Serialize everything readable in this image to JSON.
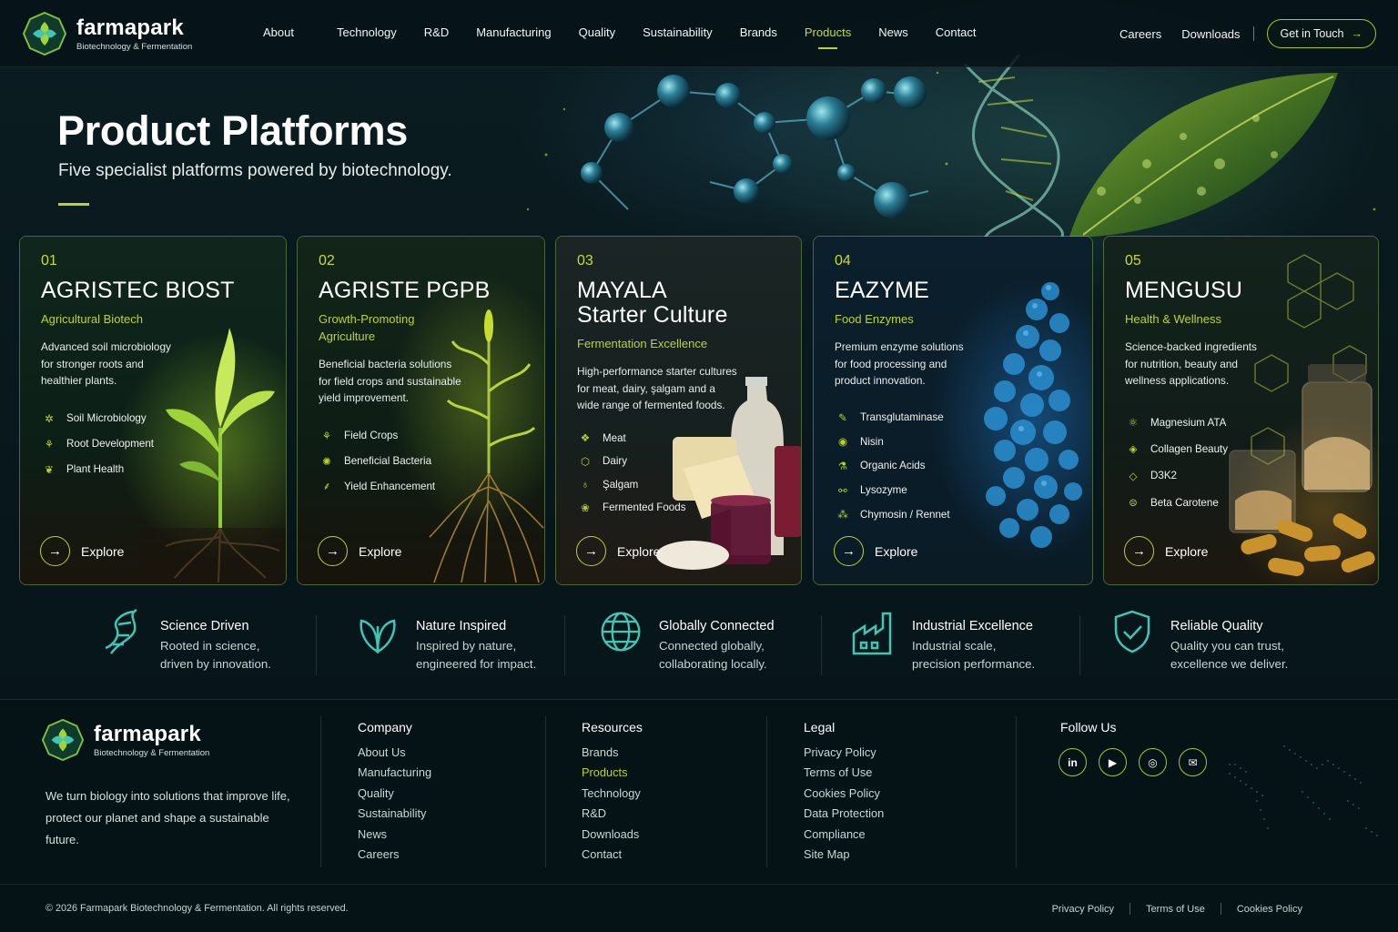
{
  "brand": {
    "name": "farmapark",
    "tagline": "Biotechnology & Fermentation"
  },
  "nav": {
    "items": [
      "About",
      "Technology",
      "R&D",
      "Manufacturing",
      "Quality",
      "Sustainability",
      "Brands",
      "Products",
      "News",
      "Contact"
    ],
    "active": "Products",
    "right": {
      "careers": "Careers",
      "downloads": "Downloads",
      "cta": "Get in Touch"
    }
  },
  "hero": {
    "title": "Product Platforms",
    "subtitle": "Five specialist platforms powered by biotechnology."
  },
  "cards": [
    {
      "num": "01",
      "title": "AGRISTEC BIOST",
      "category": "Agricultural Biotech",
      "desc": [
        "Advanced soil microbiology",
        "for stronger roots and",
        "healthier plants."
      ],
      "features": [
        {
          "icon": "microbe-icon",
          "label": "Soil Microbiology"
        },
        {
          "icon": "root-icon",
          "label": "Root Development"
        },
        {
          "icon": "leaf-icon",
          "label": "Plant Health"
        }
      ],
      "explore": "Explore"
    },
    {
      "num": "02",
      "title": "AGRISTE PGPB",
      "category": [
        "Growth-Promoting",
        "Agriculture"
      ],
      "desc": [
        "Beneficial bacteria solutions",
        "for field crops and sustainable",
        "yield improvement."
      ],
      "features": [
        {
          "icon": "sprout-icon",
          "label": "Field Crops"
        },
        {
          "icon": "bacteria-icon",
          "label": "Beneficial Bacteria"
        },
        {
          "icon": "wheat-icon",
          "label": "Yield Enhancement"
        }
      ],
      "explore": "Explore"
    },
    {
      "num": "03",
      "title": [
        "MAYALA",
        "Starter Culture"
      ],
      "category": "Fermentation Excellence",
      "desc": [
        "High-performance starter cultures",
        "for meat, dairy, şalgam and a",
        "wide range of fermented foods."
      ],
      "features": [
        {
          "icon": "meat-icon",
          "label": "Meat"
        },
        {
          "icon": "milk-drop-icon",
          "label": "Dairy"
        },
        {
          "icon": "turnip-icon",
          "label": "Şalgam"
        },
        {
          "icon": "jar-icon",
          "label": "Fermented Foods"
        }
      ],
      "explore": "Explore"
    },
    {
      "num": "04",
      "title": "EAZYME",
      "category": "Food Enzymes",
      "desc": [
        "Premium enzyme solutions",
        "for food processing and",
        "product innovation."
      ],
      "features": [
        {
          "icon": "enzyme-icon",
          "label": "Transglutaminase"
        },
        {
          "icon": "shield-drop-icon",
          "label": "Nisin"
        },
        {
          "icon": "flask-icon",
          "label": "Organic Acids"
        },
        {
          "icon": "molecule-icon",
          "label": "Lysozyme"
        },
        {
          "icon": "cluster-icon",
          "label": "Chymosin / Rennet"
        }
      ],
      "explore": "Explore"
    },
    {
      "num": "05",
      "title": "MENGUSU",
      "category": "Health & Wellness",
      "desc": [
        "Science-backed ingredients",
        "for nutrition, beauty and",
        "wellness applications."
      ],
      "features": [
        {
          "icon": "atoms-icon",
          "label": "Magnesium ATA"
        },
        {
          "icon": "drop-icon",
          "label": "Collagen Beauty"
        },
        {
          "icon": "sun-drop-icon",
          "label": "D3K2"
        },
        {
          "icon": "capsule-icon",
          "label": "Beta Carotene"
        }
      ],
      "explore": "Explore"
    }
  ],
  "values": [
    {
      "icon": "dna-icon",
      "title": "Science Driven",
      "line1": "Rooted in science,",
      "line2": "driven by innovation."
    },
    {
      "icon": "leaf-outline-icon",
      "title": "Nature Inspired",
      "line1": "Inspired by nature,",
      "line2": "engineered for impact."
    },
    {
      "icon": "globe-icon",
      "title": "Globally Connected",
      "line1": "Connected globally,",
      "line2": "collaborating locally."
    },
    {
      "icon": "factory-icon",
      "title": "Industrial Excellence",
      "line1": "Industrial scale,",
      "line2": "precision performance."
    },
    {
      "icon": "shield-check-icon",
      "title": "Reliable Quality",
      "line1": "Quality you can trust,",
      "line2": "excellence we deliver."
    }
  ],
  "footer": {
    "description": "We turn biology into solutions that improve life, protect our planet and shape a sustainable future.",
    "company": {
      "heading": "Company",
      "links": [
        "About Us",
        "Manufacturing",
        "Quality",
        "Sustainability",
        "News",
        "Careers"
      ]
    },
    "resources": {
      "heading": "Resources",
      "links": [
        "Brands",
        "Products",
        "Technology",
        "R&D",
        "Downloads",
        "Contact"
      ],
      "active": "Products"
    },
    "legal": {
      "heading": "Legal",
      "links": [
        "Privacy Policy",
        "Terms of Use",
        "Cookies Policy",
        "Data Protection",
        "Compliance",
        "Site Map"
      ]
    },
    "follow": {
      "heading": "Follow Us",
      "icons": [
        "linkedin-icon",
        "youtube-icon",
        "instagram-icon",
        "mail-icon"
      ]
    },
    "copyright": "© 2026 Farmapark Biotechnology & Fermentation. All rights reserved.",
    "bottom_links": [
      "Privacy Policy",
      "Terms of Use",
      "Cookies Policy"
    ]
  },
  "colors": {
    "accent": "#b8d42a",
    "background": "#07171b",
    "teal": "#3fc7b6"
  }
}
